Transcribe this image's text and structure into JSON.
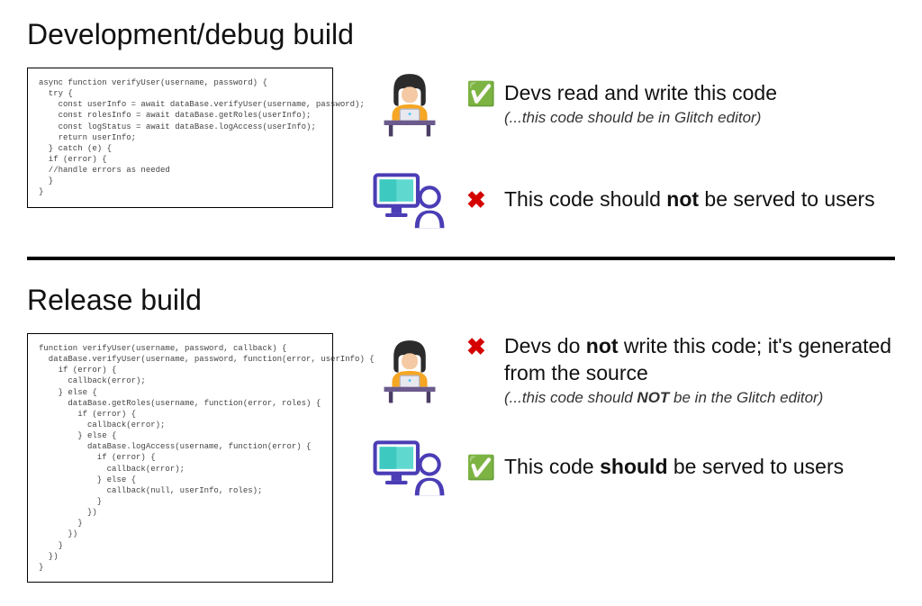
{
  "dev": {
    "title": "Development/debug build",
    "code": "async function verifyUser(username, password) {\n  try {\n    const userInfo = await dataBase.verifyUser(username, password);\n    const rolesInfo = await dataBase.getRoles(userInfo);\n    const logStatus = await dataBase.logAccess(userInfo);\n    return userInfo;\n  } catch (e) {\n  if (error) {\n  //handle errors as needed\n  }\n}",
    "item1": {
      "icon": "✅",
      "main": "Devs read and write this code",
      "sub": "(...this code should be in Glitch editor)"
    },
    "item2": {
      "icon": "✖",
      "main_pre": "This code should ",
      "main_bold": "not",
      "main_post": " be served to users"
    }
  },
  "release": {
    "title": "Release build",
    "code": "function verifyUser(username, password, callback) {\n  dataBase.verifyUser(username, password, function(error, userInfo) {\n    if (error) {\n      callback(error);\n    } else {\n      dataBase.getRoles(username, function(error, roles) {\n        if (error) {\n          callback(error);\n        } else {\n          dataBase.logAccess(username, function(error) {\n            if (error) {\n              callback(error);\n            } else {\n              callback(null, userInfo, roles);\n            }\n          })\n        }\n      })\n    }\n  })\n}",
    "item1": {
      "icon": "✖",
      "main_pre": "Devs do ",
      "main_bold": "not",
      "main_post": " write this code; it's generated from the source",
      "sub_pre": "(...this code should ",
      "sub_bold": "NOT",
      "sub_post": " be in the Glitch editor)"
    },
    "item2": {
      "icon": "✅",
      "main_pre": "This code ",
      "main_bold": "should",
      "main_post": " be served to users"
    }
  }
}
